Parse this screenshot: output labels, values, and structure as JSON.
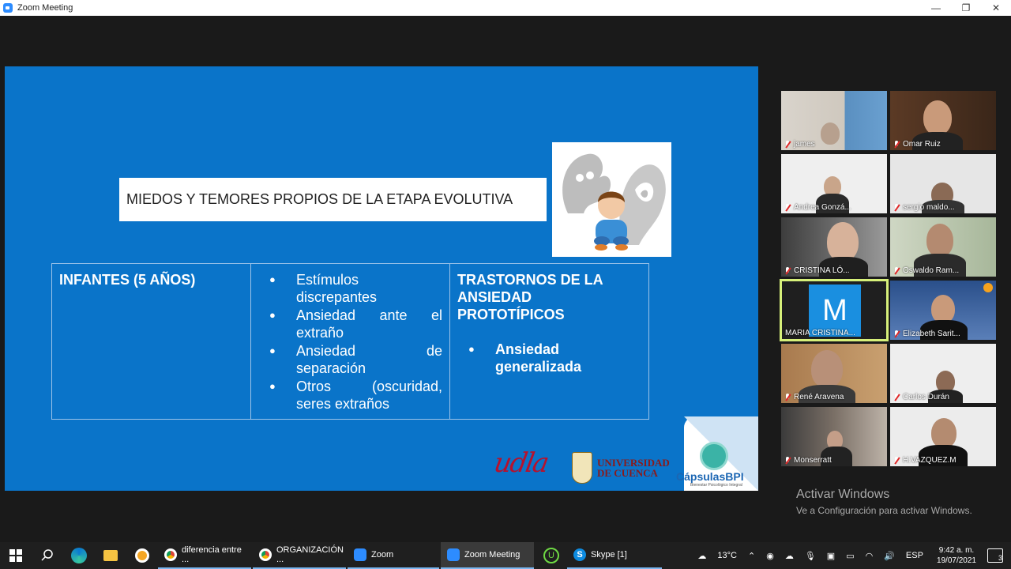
{
  "window": {
    "title": "Zoom Meeting",
    "minimize": "—",
    "maximize": "❐",
    "close": "✕"
  },
  "slide": {
    "title": "MIEDOS Y TEMORES PROPIOS DE LA ETAPA EVOLUTIVA",
    "table": {
      "col1_head": "INFANTES (5 AÑOS)",
      "col2_items": [
        "Estímulos discrepantes",
        "Ansiedad ante el extraño",
        "Ansiedad de separación",
        "Otros (oscuridad, seres extraños"
      ],
      "col3_head": "TRASTORNOS DE LA ANSIEDAD PROTOTÍPICOS",
      "col3_items": [
        "Ansiedad generalizada"
      ]
    },
    "logos": {
      "udla": "udla",
      "ucuenca_line1": "UNIVERSIDAD",
      "ucuenca_line2": "DE CUENCA",
      "capsulas": "CápsulasBPI",
      "capsulas_sub": "Bienestar Psicológico Integral"
    }
  },
  "participants": [
    {
      "name": "james"
    },
    {
      "name": "Omar Ruiz"
    },
    {
      "name": "Andrea Gonzá..."
    },
    {
      "name": "sergio maldo..."
    },
    {
      "name": "CRISTINA LÓ..."
    },
    {
      "name": "Oswaldo Ram..."
    },
    {
      "name": "MARIA CRISTINA...",
      "avatar_letter": "M"
    },
    {
      "name": "Elizabeth Sarit..."
    },
    {
      "name": "René Aravena"
    },
    {
      "name": "Carlos Durán"
    },
    {
      "name": "Monserratt"
    },
    {
      "name": "H.VAZQUEZ.M"
    }
  ],
  "watermark": {
    "line1": "Activar Windows",
    "line2": "Ve a Configuración para activar Windows."
  },
  "taskbar": {
    "apps": [
      {
        "label": "diferencia entre ..."
      },
      {
        "label": "ORGANIZACIÓN ..."
      },
      {
        "label": "Zoom"
      },
      {
        "label": "Zoom Meeting"
      },
      {
        "label": "Skype [1]"
      }
    ],
    "temperature": "13°C",
    "language": "ESP",
    "time": "9:42 a. m.",
    "date": "19/07/2021",
    "notifications": "3"
  },
  "colors": {
    "slide_bg": "#0a74c9",
    "active_speaker": "#d7f07a",
    "zoom_blue": "#2d8cff"
  }
}
